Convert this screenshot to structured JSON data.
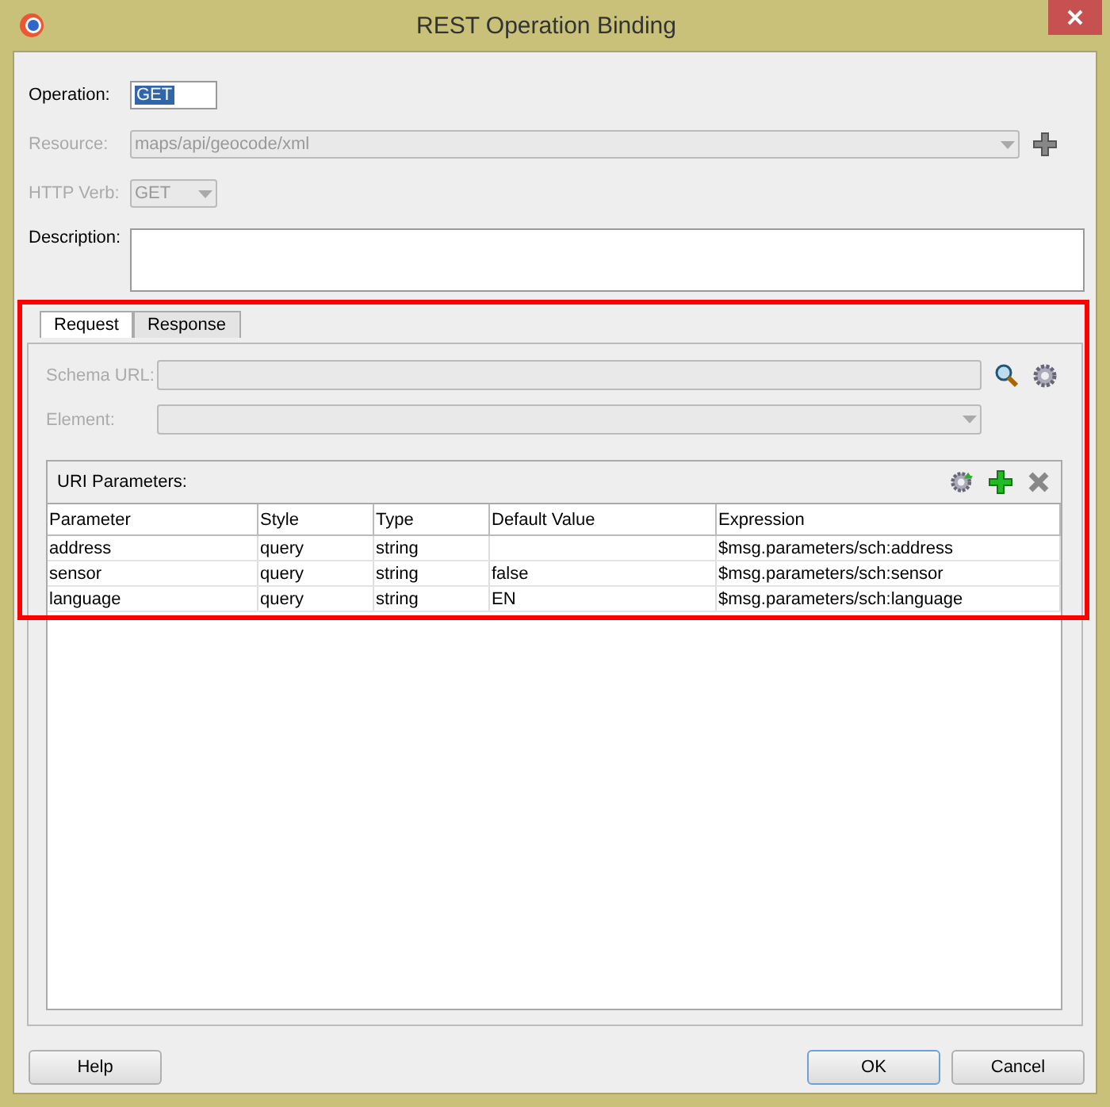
{
  "window": {
    "title": "REST Operation Binding"
  },
  "operation": {
    "label": "Operation:",
    "value": "GET"
  },
  "resource": {
    "label": "Resource:",
    "value": "maps/api/geocode/xml",
    "disabled": true
  },
  "http_verb": {
    "label": "HTTP Verb:",
    "value": "GET",
    "disabled": true
  },
  "description": {
    "label": "Description:"
  },
  "tabs": [
    {
      "label": "Request",
      "selected": true
    },
    {
      "label": "Response",
      "selected": false
    }
  ],
  "schema_url": {
    "label": "Schema URL:",
    "disabled": true
  },
  "element": {
    "label": "Element:",
    "disabled": true
  },
  "uri_parameters": {
    "title": "URI Parameters:",
    "columns": [
      "Parameter",
      "Style",
      "Type",
      "Default Value",
      "Expression"
    ],
    "rows": [
      [
        "address",
        "query",
        "string",
        "",
        "$msg.parameters/sch:address"
      ],
      [
        "sensor",
        "query",
        "string",
        "false",
        "$msg.parameters/sch:sensor"
      ],
      [
        "language",
        "query",
        "string",
        "EN",
        "$msg.parameters/sch:language"
      ]
    ]
  },
  "buttons": [
    {
      "label": "Help",
      "kind": "left",
      "default": false
    },
    {
      "label": "OK",
      "kind": "right",
      "default": true
    },
    {
      "label": "Cancel",
      "kind": "right",
      "default": false
    }
  ]
}
